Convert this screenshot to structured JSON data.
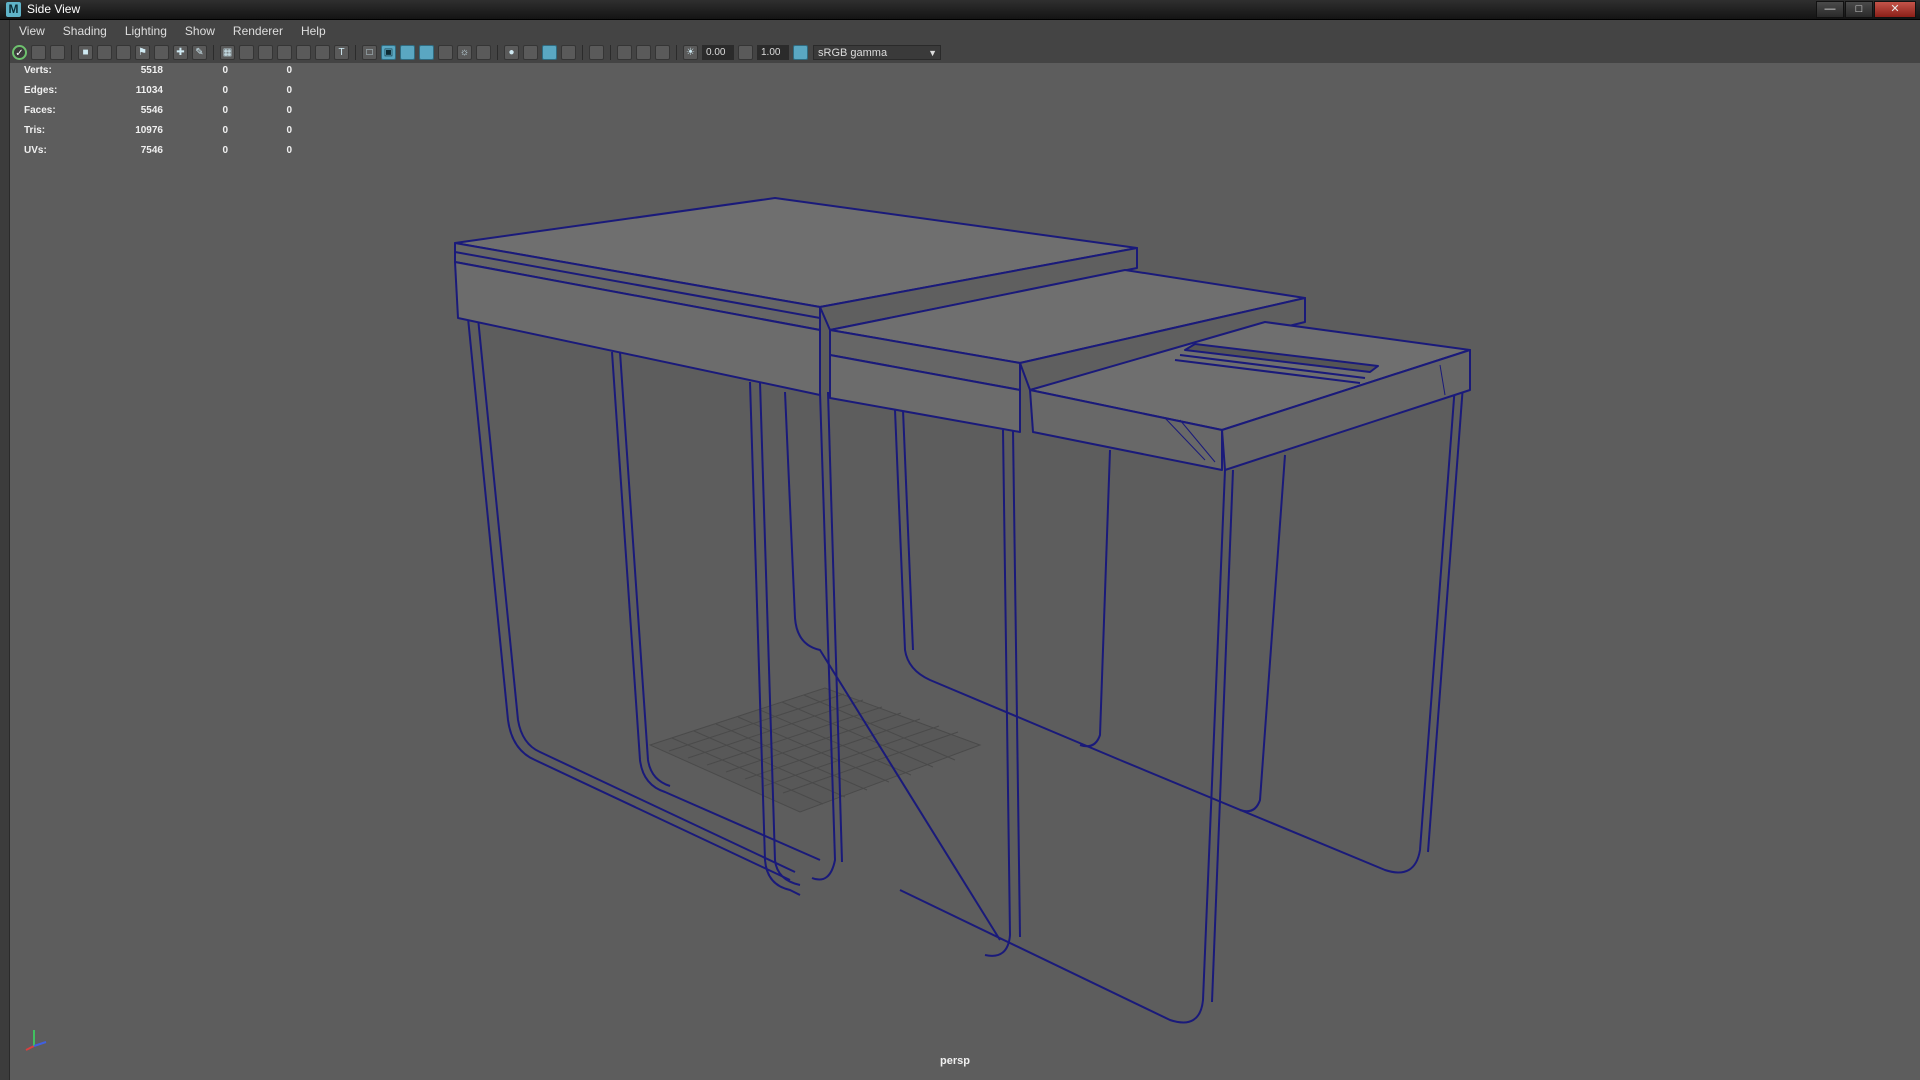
{
  "window": {
    "title": "Side View",
    "app_icon_letter": "M",
    "buttons": [
      "minimize",
      "maximize",
      "close"
    ]
  },
  "menubar": {
    "items": [
      "View",
      "Shading",
      "Lighting",
      "Show",
      "Renderer",
      "Help"
    ]
  },
  "toolbar": {
    "exposure_value": "0.00",
    "gamma_value": "1.00",
    "color_space": "sRGB gamma"
  },
  "hud": {
    "rows": [
      {
        "label": "Verts:",
        "v1": "5518",
        "v2": "0",
        "v3": "0"
      },
      {
        "label": "Edges:",
        "v1": "11034",
        "v2": "0",
        "v3": "0"
      },
      {
        "label": "Faces:",
        "v1": "5546",
        "v2": "0",
        "v3": "0"
      },
      {
        "label": "Tris:",
        "v1": "10976",
        "v2": "0",
        "v3": "0"
      },
      {
        "label": "UVs:",
        "v1": "7546",
        "v2": "0",
        "v3": "0"
      }
    ]
  },
  "viewport": {
    "camera": "persp"
  },
  "colors": {
    "background": "#5d5d5d",
    "wireframe": "#1a1a7a",
    "surface": "#6f6f6f",
    "accent": "#5aa7c2"
  }
}
